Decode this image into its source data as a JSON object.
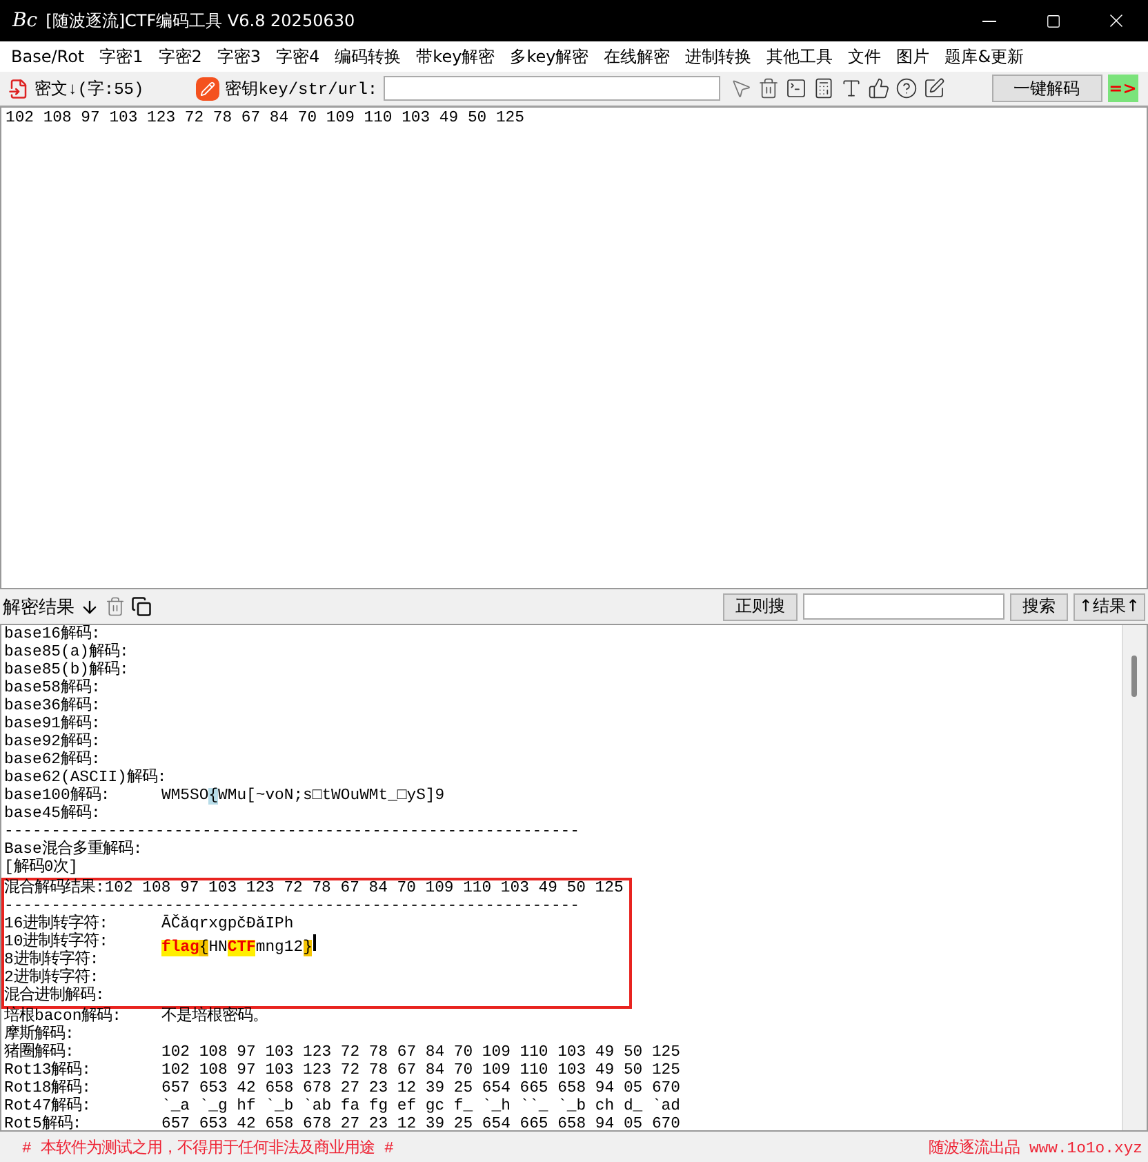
{
  "window": {
    "logo": "Bc",
    "title": "[随波逐流]CTF编码工具 V6.8  20250630"
  },
  "menu": [
    "Base/Rot",
    "字密1",
    "字密2",
    "字密3",
    "字密4",
    "编码转换",
    "带key解密",
    "多key解密",
    "在线解密",
    "进制转换",
    "其他工具",
    "文件",
    "图片",
    "题库&更新"
  ],
  "toolbar": {
    "cipher_label": "密文↓(字:55)",
    "key_label": "密钥key/str/url:",
    "decode_button": "一键解码",
    "arrow": "=>"
  },
  "input_text": "102 108 97 103 123 72 78 67 84 70 109 110 103 49 50 125",
  "results_bar": {
    "label": "解密结果",
    "regex_button": "正则搜",
    "search_button": "搜索",
    "result_button": "↑结果↑"
  },
  "result_lines": [
    {
      "kind": "field",
      "label": "base16解码:",
      "framed": false
    },
    {
      "kind": "field",
      "label": "base85(a)解码:",
      "framed": false
    },
    {
      "kind": "field",
      "label": "base85(b)解码:",
      "framed": false
    },
    {
      "kind": "field",
      "label": "base58解码:",
      "framed": false
    },
    {
      "kind": "field",
      "label": "base36解码:",
      "framed": false
    },
    {
      "kind": "field",
      "label": "base91解码:",
      "framed": false
    },
    {
      "kind": "field",
      "label": "base92解码:",
      "framed": false
    },
    {
      "kind": "field",
      "label": "base62解码:",
      "framed": false
    },
    {
      "kind": "field",
      "label": "base62(ASCII)解码:",
      "framed": false
    },
    {
      "kind": "field",
      "label": "base100解码:",
      "framed": false,
      "segments": [
        {
          "text": "WM5SO",
          "kind": "plain"
        },
        {
          "text": "{",
          "kind": "cursor"
        },
        {
          "text": "WMu[~voN;s□tWOuWMt_□yS]9",
          "kind": "plain"
        }
      ]
    },
    {
      "kind": "field",
      "label": "base45解码:",
      "framed": false
    },
    {
      "kind": "rule",
      "text": "-------------------------------------------------------------",
      "framed": false
    },
    {
      "kind": "field",
      "label": "Base混合多重解码:",
      "framed": false
    },
    {
      "kind": "field",
      "label": "[解码0次]",
      "framed": false
    },
    {
      "kind": "inline",
      "label": "混合解码结果:",
      "value": "102 108 97 103 123 72 78 67 84 70 109 110 103 49 50 125",
      "framed": true
    },
    {
      "kind": "rule",
      "text": "-------------------------------------------------------------",
      "framed": true
    },
    {
      "kind": "field",
      "label": "16进制转字符:",
      "framed": true,
      "segments": [
        {
          "text": "ĀČăqrxgpčĐăIPh",
          "kind": "plain"
        }
      ]
    },
    {
      "kind": "field",
      "label": "10进制转字符:",
      "framed": true,
      "segments": [
        {
          "text": "flag",
          "kind": "keyword"
        },
        {
          "text": "{",
          "kind": "bracket"
        },
        {
          "text": "HN",
          "kind": "plain"
        },
        {
          "text": "CTF",
          "kind": "keyword"
        },
        {
          "text": "mng12",
          "kind": "plain"
        },
        {
          "text": "}",
          "kind": "bracket"
        }
      ]
    },
    {
      "kind": "field",
      "label": "8进制转字符:",
      "framed": true
    },
    {
      "kind": "field",
      "label": "2进制转字符:",
      "framed": true
    },
    {
      "kind": "field",
      "label": "混合进制解码:",
      "framed": true
    },
    {
      "kind": "field",
      "label": "培根bacon解码:",
      "framed": false,
      "segments": [
        {
          "text": "不是培根密码。",
          "kind": "plain"
        }
      ]
    },
    {
      "kind": "field",
      "label": "摩斯解码:",
      "framed": false
    },
    {
      "kind": "field",
      "label": "猪圈解码:",
      "framed": false,
      "segments": [
        {
          "text": "102 108 97 103 123 72 78 67 84 70 109 110 103 49 50 125",
          "kind": "plain"
        }
      ]
    },
    {
      "kind": "field",
      "label": "Rot13解码:",
      "framed": false,
      "segments": [
        {
          "text": "102 108 97 103 123 72 78 67 84 70 109 110 103 49 50 125",
          "kind": "plain"
        }
      ]
    },
    {
      "kind": "field",
      "label": "Rot18解码:",
      "framed": false,
      "segments": [
        {
          "text": "657 653 42 658 678 27 23 12 39 25 654 665 658 94 05 670",
          "kind": "plain"
        }
      ]
    },
    {
      "kind": "field",
      "label": "Rot47解码:",
      "framed": false,
      "segments": [
        {
          "text": "`_a `_g hf `_b `ab fa fg ef gc f_ `_h ``_ `_b ch d_ `ad",
          "kind": "plain"
        }
      ]
    },
    {
      "kind": "field",
      "label": "Rot5解码:",
      "framed": false,
      "segments": [
        {
          "text": "657 653 42 658 678 27 23 12 39 25 654 665 658 94 05 670",
          "kind": "plain"
        }
      ]
    }
  ],
  "footer": {
    "notice": "# 本软件为测试之用，不得用于任何非法及商业用途 #",
    "credit": "随波逐流出品 www.1o1o.xyz"
  }
}
